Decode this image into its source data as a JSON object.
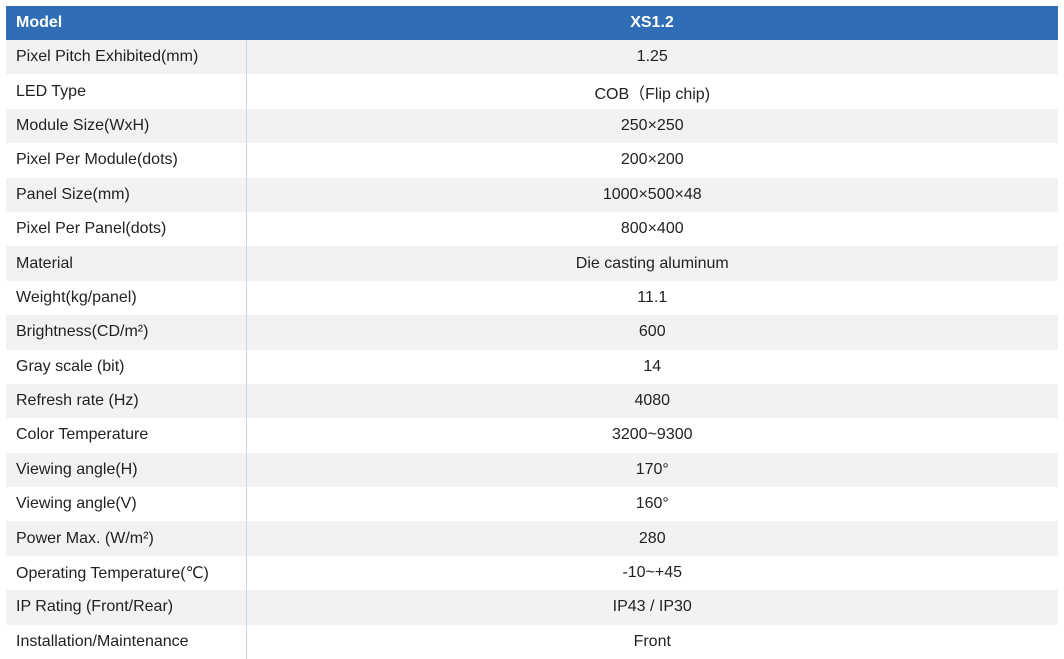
{
  "header": {
    "label": "Model",
    "value": "XS1.2"
  },
  "rows": [
    {
      "label": "Pixel Pitch Exhibited(mm)",
      "value": "1.25"
    },
    {
      "label": "LED Type",
      "value": "COB（Flip chip)"
    },
    {
      "label": "Module Size(WxH)",
      "value": "250×250"
    },
    {
      "label": "Pixel Per Module(dots)",
      "value": "200×200"
    },
    {
      "label": "Panel Size(mm)",
      "value": "1000×500×48"
    },
    {
      "label": "Pixel Per Panel(dots)",
      "value": "800×400"
    },
    {
      "label": "Material",
      "value": "Die casting aluminum"
    },
    {
      "label": "Weight(kg/panel)",
      "value": "11.1"
    },
    {
      "label": "Brightness(CD/m²)",
      "value": "600"
    },
    {
      "label": "Gray scale (bit)",
      "value": "14"
    },
    {
      "label": "Refresh rate (Hz)",
      "value": "4080"
    },
    {
      "label": "Color Temperature",
      "value": "3200~9300"
    },
    {
      "label": "Viewing angle(H)",
      "value": "170°"
    },
    {
      "label": "Viewing angle(V)",
      "value": "160°"
    },
    {
      "label": "Power Max. (W/m²)",
      "value": "280"
    },
    {
      "label": "Operating Temperature(℃)",
      "value": "-10~+45"
    },
    {
      "label": "IP Rating (Front/Rear)",
      "value": "IP43 / IP30"
    },
    {
      "label": "Installation/Maintenance",
      "value": "Front"
    }
  ],
  "colors": {
    "header_bg": "#2f6db5",
    "header_text": "#ffffff",
    "row_alt_bg": "#f2f2f2",
    "row_bg": "#ffffff",
    "text": "#222222",
    "divider": "#c9d6e6"
  }
}
